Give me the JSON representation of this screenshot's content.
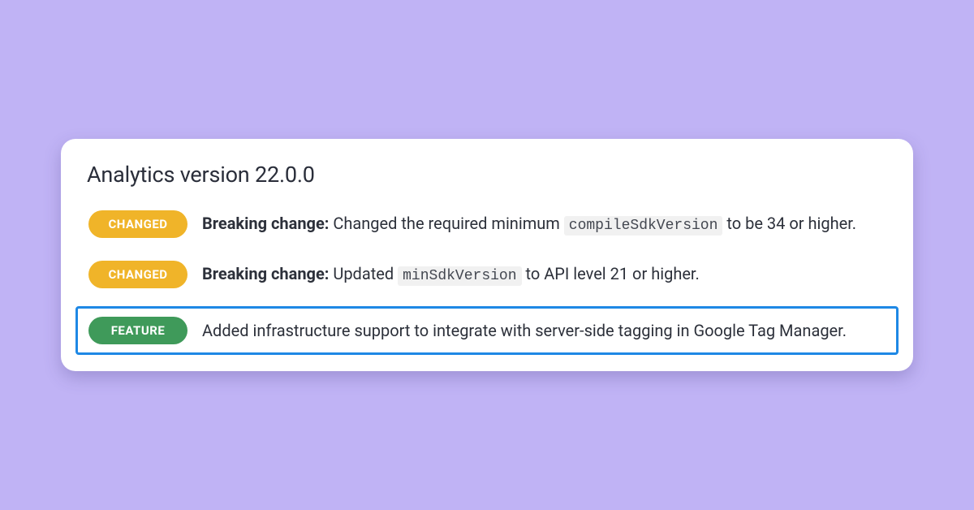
{
  "colors": {
    "background": "#C0B3F5",
    "card_bg": "#ffffff",
    "badge_changed": "#F0B429",
    "badge_feature": "#3F9A5A",
    "highlight_border": "#1E88E5"
  },
  "title": "Analytics version 22.0.0",
  "items": [
    {
      "badge_type": "CHANGED",
      "badge_class": "changed",
      "highlighted": false,
      "prefix_bold": "Breaking change:",
      "text_before_code": " Changed the required minimum ",
      "code": "compileSdkVersion",
      "text_after_code": " to be 34 or higher."
    },
    {
      "badge_type": "CHANGED",
      "badge_class": "changed",
      "highlighted": false,
      "prefix_bold": "Breaking change:",
      "text_before_code": " Updated ",
      "code": "minSdkVersion",
      "text_after_code": " to API level 21 or higher."
    },
    {
      "badge_type": "FEATURE",
      "badge_class": "feature",
      "highlighted": true,
      "prefix_bold": "",
      "text_before_code": "Added infrastructure support to integrate with server-side tagging in Google Tag Manager.",
      "code": "",
      "text_after_code": ""
    }
  ]
}
